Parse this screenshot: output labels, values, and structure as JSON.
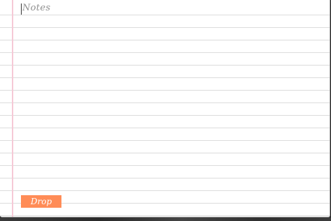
{
  "notes": {
    "placeholder": "Notes",
    "value": ""
  },
  "actions": {
    "drop_label": "Drop"
  },
  "colors": {
    "paper": "#ffffff",
    "rule_line": "#dcdcdc",
    "margin_line": "#f6c9d6",
    "drop_button": "#ff8c57",
    "placeholder_text": "#8f8f8f"
  }
}
